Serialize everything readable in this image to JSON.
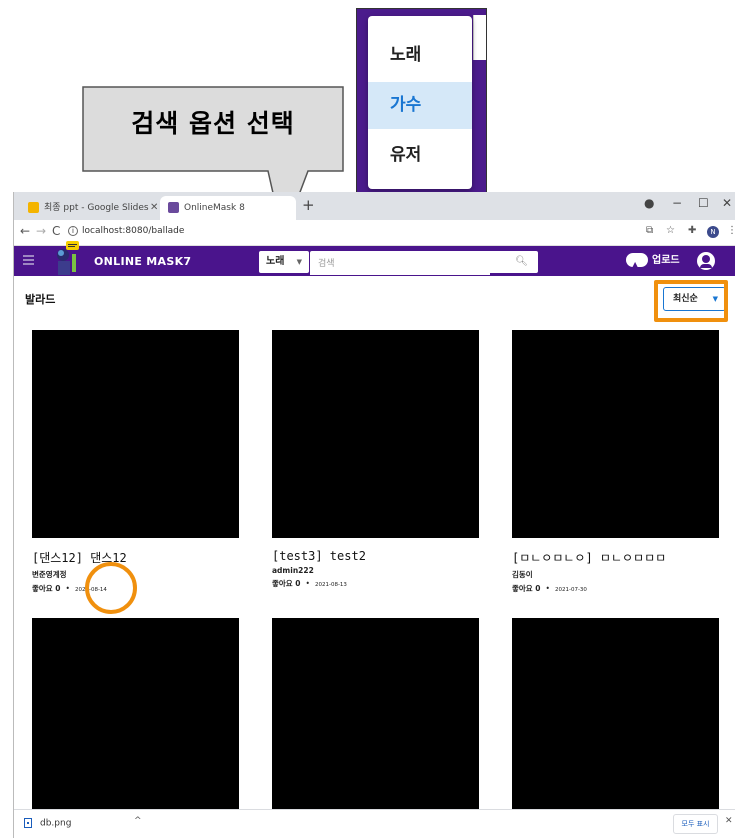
{
  "callout": {
    "text": "검색 옵션 선택"
  },
  "dropdown_popup": {
    "items": [
      "노래",
      "가수",
      "유저"
    ],
    "selected_index": 1
  },
  "browser": {
    "tabs": [
      {
        "title": "최종 ppt - Google Slides",
        "active": false
      },
      {
        "title": "OnlineMask 8",
        "active": true
      }
    ],
    "new_tab": "+",
    "url": "localhost:8080/ballade"
  },
  "header": {
    "brand": "ONLINE MASK7",
    "search_type": "노래",
    "search_placeholder": "검색",
    "upload_label": "업로드"
  },
  "page": {
    "title": "발라드",
    "sort_label": "최신순"
  },
  "cards": [
    {
      "title": "[댄스12] 댄스12",
      "author": "변준영계정",
      "likes": "좋아요 0",
      "date": "2021-08-14"
    },
    {
      "title": "[test3] test2",
      "author": "admin222",
      "likes": "좋아요 0",
      "date": "2021-08-13"
    },
    {
      "title": "[ㅁㄴㅇㅁㄴㅇ] ㅁㄴㅇㅁㅁㅁ",
      "author": "김동이",
      "likes": "좋아요 0",
      "date": "2021-07-30"
    },
    {
      "title": "",
      "author": "",
      "likes": "",
      "date": ""
    },
    {
      "title": "",
      "author": "",
      "likes": "",
      "date": ""
    },
    {
      "title": "",
      "author": "",
      "likes": "",
      "date": ""
    }
  ],
  "download_bar": {
    "filename": "db.png",
    "show_all": "모두 표시"
  },
  "colors": {
    "appbar": "#4a148c",
    "highlight": "#f0900e",
    "accent": "#1976d2"
  }
}
